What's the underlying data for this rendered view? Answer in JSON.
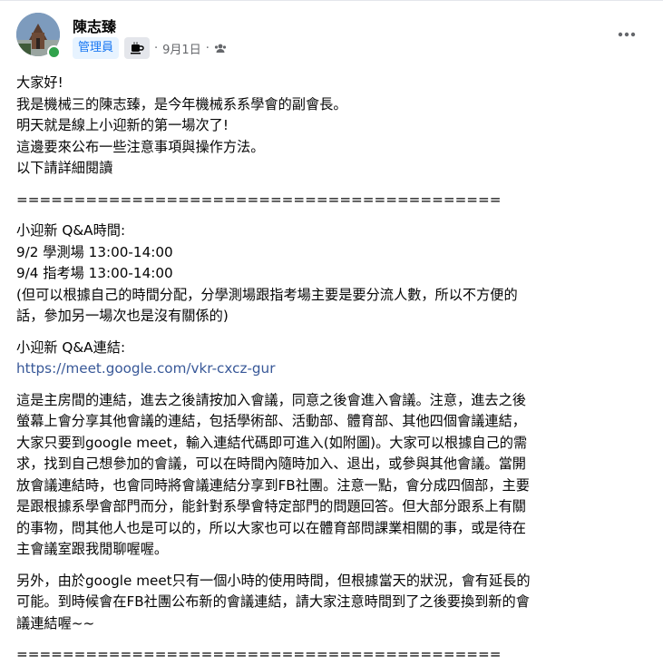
{
  "post": {
    "author": "陳志臻",
    "badge": "管理員",
    "badge_icon": "coffee-cup-icon",
    "date": "9月1日",
    "dot": "·",
    "privacy_icon": "group-privacy-icon",
    "more_icon": "more-options-icon"
  },
  "body": {
    "p1": [
      "大家好!",
      "我是機械三的陳志臻，是今年機械系系學會的副會長。",
      "明天就是線上小迎新的第一場次了!",
      "這邊要來公布一些注意事項與操作方法。",
      "以下請詳細閱讀"
    ],
    "divider": "==========================================",
    "qa_time": [
      "小迎新 Q&A時間:",
      "9/2 學測場 13:00-14:00",
      "9/4 指考場 13:00-14:00",
      "(但可以根據自己的時間分配，分學測場跟指考場主要是要分流人數，所以不方便的",
      "話，參加另一場次也是沒有關係的)"
    ],
    "link_title": "小迎新 Q&A連結:",
    "link_url": "https://meet.google.com/vkr-cxcz-gur",
    "p_main": [
      "這是主房間的連結，進去之後請按加入會議，同意之後會進入會議。注意，進去之後",
      "螢幕上會分享其他會議的連結，包括學術部、活動部、體育部、其他四個會議連結，",
      "大家只要到google meet，輸入連結代碼即可進入(如附圖)。大家可以根據自己的需",
      "求，找到自己想參加的會議，可以在時間內隨時加入、退出，或參與其他會議。當開",
      "放會議連結時，也會同時將會議連結分享到FB社團。注意一點，會分成四個部，主要",
      "是跟根據系學會部門而分，能針對系學會特定部門的問題回答。但大部分跟系上有關",
      "的事物，問其他人也是可以的，所以大家也可以在體育部問課業相關的事，或是待在",
      "主會議室跟我閒聊喔喔。"
    ],
    "p_extra": [
      "另外，由於google meet只有一個小時的使用時間，但根據當天的狀況，會有延長的",
      "可能。到時候會在FB社團公布新的會議連結，請大家注意時間到了之後要換到新的會",
      "議連結喔~~"
    ],
    "divider2": "=========================================="
  }
}
